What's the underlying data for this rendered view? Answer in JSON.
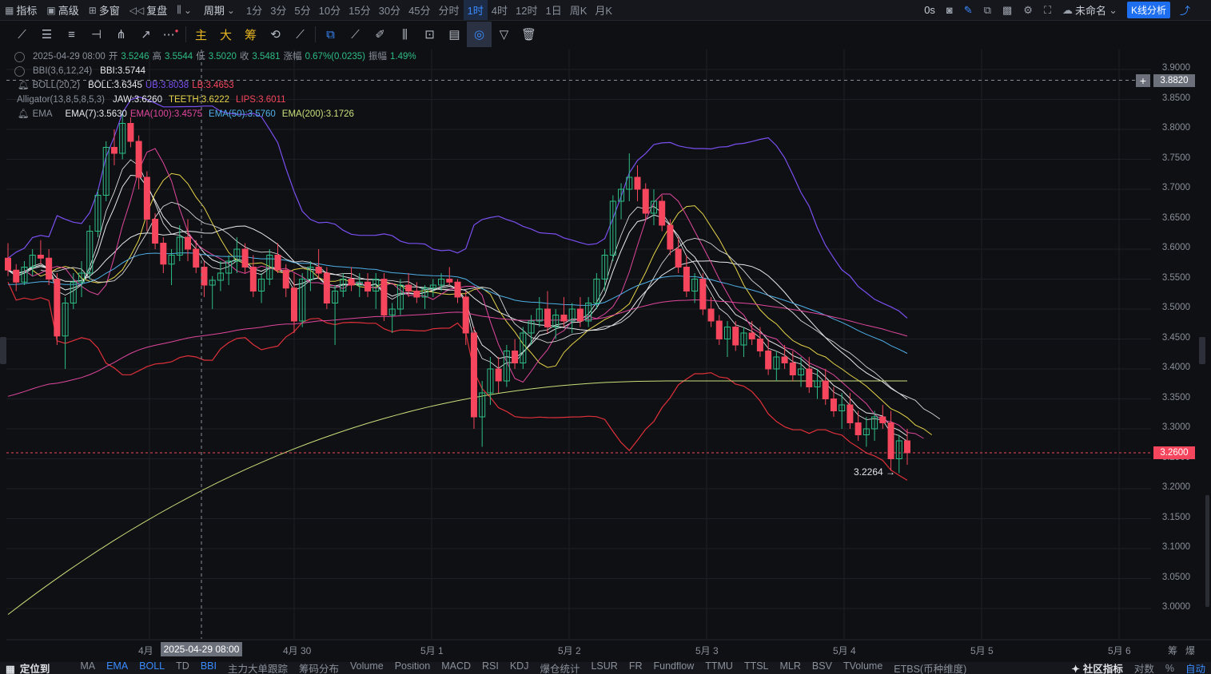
{
  "topbar": {
    "indicators": "指标",
    "advanced": "高级",
    "multiwindow": "多窗",
    "replay": "复盘",
    "period": "周期",
    "timeframes": [
      "1分",
      "3分",
      "5分",
      "10分",
      "15分",
      "30分",
      "45分",
      "分时",
      "1时",
      "4时",
      "12时",
      "1日",
      "周K",
      "月K"
    ],
    "active_timeframe": "1时",
    "clock": "0s",
    "unnamed": "未命名",
    "kline_analysis": "K线分析"
  },
  "toolbar2": {
    "main": "主",
    "big": "大",
    "chips": "筹"
  },
  "legend": {
    "ohlc": {
      "date": "2025-04-29 08:00",
      "open_label": "开",
      "open": "3.5246",
      "high_label": "高",
      "high": "3.5544",
      "low_label": "低",
      "low": "3.5020",
      "close_label": "收",
      "close": "3.5481",
      "change_label": "涨幅",
      "change": "0.67%(0.0235)",
      "amp_label": "振幅",
      "amp": "1.49%"
    },
    "bbi": {
      "name": "BBI(3,6,12,24)",
      "value": "BBI:3.5744"
    },
    "boll": {
      "name": "BOLL(20,2)",
      "mid": "BOLL:3.6345",
      "up": "UB:3.8038",
      "low": "LB:3.4653"
    },
    "alligator": {
      "name": "Alligator(13,8,5,8,5,3)",
      "jaw": "JAW:3.6260",
      "teeth": "TEETH:3.6222",
      "lips": "LIPS:3.6011"
    },
    "ema": {
      "name": "EMA",
      "ema7": "EMA(7):3.5630",
      "ema100": "EMA(100):3.4575",
      "ema50": "EMA(50):3.5760",
      "ema200": "EMA(200):3.1726"
    }
  },
  "axis": {
    "price_ticks": [
      "3.9000",
      "3.8500",
      "3.8000",
      "3.7500",
      "3.7000",
      "3.6500",
      "3.6000",
      "3.5500",
      "3.5000",
      "3.4500",
      "3.4000",
      "3.3500",
      "3.3000",
      "3.2500",
      "3.2000",
      "3.1500",
      "3.1000",
      "3.0500",
      "3.0000"
    ],
    "crosshair_price": "3.8820",
    "last_price": "3.2600",
    "low_marker": "3.2264",
    "date_ticks": [
      "4月",
      "4月 30",
      "5月 1",
      "5月 2",
      "5月 3",
      "5月 4",
      "5月 5",
      "5月 6"
    ],
    "crosshair_date": "2025-04-29 08:00",
    "bottom_right": [
      "筹",
      "爆"
    ]
  },
  "colors": {
    "up": "#2ebd85",
    "down": "#f6465d",
    "accent": "#3a8bff",
    "bg": "#0f1014"
  },
  "bottombar": {
    "locate": "定位到",
    "items": [
      "MA",
      "EMA",
      "BOLL",
      "TD",
      "BBI",
      "主力大单跟踪",
      "筹码分布",
      "Volume",
      "Position",
      "MACD",
      "RSI",
      "KDJ",
      "爆仓统计",
      "LSUR",
      "FR",
      "Fundflow",
      "TTMU",
      "TTSL",
      "MLR",
      "BSV",
      "TVolume",
      "ETBS(币种维度)"
    ],
    "active": [
      "EMA",
      "BOLL",
      "BBI"
    ],
    "community": "社区指标",
    "log": "对数",
    "pct": "%",
    "auto": "自动"
  },
  "chart_data": {
    "type": "candlestick",
    "timeframe": "1H",
    "ylim": [
      2.97,
      3.93
    ],
    "candles_approx": [
      [
        3.585,
        3.61,
        3.555,
        3.565
      ],
      [
        3.565,
        3.575,
        3.53,
        3.545
      ],
      [
        3.545,
        3.58,
        3.54,
        3.57
      ],
      [
        3.57,
        3.6,
        3.555,
        3.59
      ],
      [
        3.59,
        3.615,
        3.575,
        3.585
      ],
      [
        3.585,
        3.6,
        3.54,
        3.55
      ],
      [
        3.55,
        3.56,
        3.44,
        3.455
      ],
      [
        3.455,
        3.52,
        3.4,
        3.51
      ],
      [
        3.51,
        3.56,
        3.5,
        3.545
      ],
      [
        3.545,
        3.58,
        3.52,
        3.56
      ],
      [
        3.56,
        3.64,
        3.55,
        3.63
      ],
      [
        3.63,
        3.7,
        3.62,
        3.69
      ],
      [
        3.69,
        3.78,
        3.68,
        3.77
      ],
      [
        3.77,
        3.8,
        3.74,
        3.76
      ],
      [
        3.76,
        3.83,
        3.75,
        3.81
      ],
      [
        3.81,
        3.82,
        3.77,
        3.78
      ],
      [
        3.78,
        3.79,
        3.7,
        3.72
      ],
      [
        3.72,
        3.73,
        3.63,
        3.65
      ],
      [
        3.65,
        3.66,
        3.6,
        3.61
      ],
      [
        3.61,
        3.62,
        3.56,
        3.575
      ],
      [
        3.575,
        3.6,
        3.54,
        3.59
      ],
      [
        3.59,
        3.64,
        3.58,
        3.62
      ],
      [
        3.62,
        3.65,
        3.58,
        3.6
      ],
      [
        3.6,
        3.615,
        3.56,
        3.57
      ],
      [
        3.57,
        3.58,
        3.52,
        3.54
      ],
      [
        3.54,
        3.555,
        3.5,
        3.548
      ],
      [
        3.548,
        3.58,
        3.53,
        3.56
      ],
      [
        3.56,
        3.59,
        3.54,
        3.58
      ],
      [
        3.58,
        3.62,
        3.56,
        3.6
      ],
      [
        3.6,
        3.61,
        3.56,
        3.57
      ],
      [
        3.57,
        3.59,
        3.52,
        3.53
      ],
      [
        3.53,
        3.56,
        3.51,
        3.55
      ],
      [
        3.55,
        3.6,
        3.54,
        3.59
      ],
      [
        3.59,
        3.61,
        3.56,
        3.565
      ],
      [
        3.565,
        3.575,
        3.52,
        3.535
      ],
      [
        3.535,
        3.56,
        3.46,
        3.48
      ],
      [
        3.48,
        3.56,
        3.47,
        3.55
      ],
      [
        3.55,
        3.58,
        3.53,
        3.57
      ],
      [
        3.57,
        3.6,
        3.55,
        3.56
      ],
      [
        3.56,
        3.57,
        3.5,
        3.51
      ],
      [
        3.51,
        3.54,
        3.44,
        3.53
      ],
      [
        3.53,
        3.56,
        3.52,
        3.55
      ],
      [
        3.55,
        3.57,
        3.53,
        3.54
      ],
      [
        3.54,
        3.56,
        3.52,
        3.545
      ],
      [
        3.545,
        3.56,
        3.52,
        3.53
      ],
      [
        3.53,
        3.56,
        3.5,
        3.55
      ],
      [
        3.55,
        3.56,
        3.48,
        3.49
      ],
      [
        3.49,
        3.51,
        3.46,
        3.5
      ],
      [
        3.5,
        3.55,
        3.49,
        3.54
      ],
      [
        3.54,
        3.56,
        3.52,
        3.53
      ],
      [
        3.53,
        3.545,
        3.51,
        3.52
      ],
      [
        3.52,
        3.54,
        3.5,
        3.535
      ],
      [
        3.535,
        3.55,
        3.52,
        3.54
      ],
      [
        3.54,
        3.56,
        3.53,
        3.55
      ],
      [
        3.55,
        3.57,
        3.54,
        3.545
      ],
      [
        3.545,
        3.55,
        3.51,
        3.52
      ],
      [
        3.52,
        3.53,
        3.44,
        3.46
      ],
      [
        3.46,
        3.47,
        3.3,
        3.32
      ],
      [
        3.32,
        3.38,
        3.27,
        3.36
      ],
      [
        3.36,
        3.42,
        3.34,
        3.4
      ],
      [
        3.4,
        3.42,
        3.36,
        3.38
      ],
      [
        3.38,
        3.44,
        3.37,
        3.43
      ],
      [
        3.43,
        3.45,
        3.4,
        3.41
      ],
      [
        3.41,
        3.47,
        3.4,
        3.46
      ],
      [
        3.46,
        3.49,
        3.44,
        3.48
      ],
      [
        3.48,
        3.52,
        3.47,
        3.5
      ],
      [
        3.5,
        3.53,
        3.46,
        3.47
      ],
      [
        3.47,
        3.5,
        3.45,
        3.49
      ],
      [
        3.49,
        3.52,
        3.47,
        3.48
      ],
      [
        3.48,
        3.51,
        3.46,
        3.5
      ],
      [
        3.5,
        3.52,
        3.47,
        3.48
      ],
      [
        3.48,
        3.52,
        3.47,
        3.51
      ],
      [
        3.51,
        3.56,
        3.5,
        3.55
      ],
      [
        3.55,
        3.6,
        3.53,
        3.59
      ],
      [
        3.59,
        3.69,
        3.58,
        3.68
      ],
      [
        3.68,
        3.71,
        3.65,
        3.7
      ],
      [
        3.7,
        3.76,
        3.68,
        3.72
      ],
      [
        3.72,
        3.74,
        3.68,
        3.7
      ],
      [
        3.7,
        3.71,
        3.65,
        3.66
      ],
      [
        3.66,
        3.7,
        3.64,
        3.68
      ],
      [
        3.68,
        3.69,
        3.63,
        3.64
      ],
      [
        3.64,
        3.65,
        3.59,
        3.6
      ],
      [
        3.6,
        3.62,
        3.56,
        3.57
      ],
      [
        3.57,
        3.59,
        3.52,
        3.53
      ],
      [
        3.53,
        3.56,
        3.51,
        3.55
      ],
      [
        3.55,
        3.56,
        3.49,
        3.5
      ],
      [
        3.5,
        3.52,
        3.47,
        3.48
      ],
      [
        3.48,
        3.49,
        3.44,
        3.45
      ],
      [
        3.45,
        3.48,
        3.42,
        3.47
      ],
      [
        3.47,
        3.48,
        3.43,
        3.44
      ],
      [
        3.44,
        3.47,
        3.42,
        3.46
      ],
      [
        3.46,
        3.48,
        3.44,
        3.45
      ],
      [
        3.45,
        3.47,
        3.42,
        3.43
      ],
      [
        3.43,
        3.45,
        3.39,
        3.4
      ],
      [
        3.4,
        3.43,
        3.38,
        3.42
      ],
      [
        3.42,
        3.44,
        3.4,
        3.41
      ],
      [
        3.41,
        3.43,
        3.38,
        3.39
      ],
      [
        3.39,
        3.42,
        3.37,
        3.4
      ],
      [
        3.4,
        3.42,
        3.36,
        3.37
      ],
      [
        3.37,
        3.4,
        3.35,
        3.38
      ],
      [
        3.38,
        3.4,
        3.34,
        3.35
      ],
      [
        3.35,
        3.37,
        3.32,
        3.33
      ],
      [
        3.33,
        3.36,
        3.3,
        3.34
      ],
      [
        3.34,
        3.36,
        3.3,
        3.31
      ],
      [
        3.31,
        3.33,
        3.28,
        3.29
      ],
      [
        3.29,
        3.32,
        3.27,
        3.3
      ],
      [
        3.3,
        3.33,
        3.28,
        3.32
      ],
      [
        3.32,
        3.34,
        3.3,
        3.31
      ],
      [
        3.31,
        3.33,
        3.23,
        3.25
      ],
      [
        3.25,
        3.29,
        3.226,
        3.28
      ],
      [
        3.28,
        3.3,
        3.24,
        3.26
      ]
    ],
    "last_price": 3.26,
    "low_marker": 3.2264
  }
}
